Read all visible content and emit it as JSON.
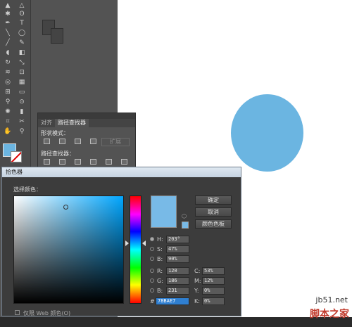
{
  "colors": {
    "accent": "#78bae7",
    "ellipse": "#6bb5e1",
    "dark_ui": "#535353"
  },
  "pathfinder": {
    "tabs": [
      "对齐",
      "路径查找器"
    ],
    "shape_modes_label": "形状模式：",
    "pathfinders_label": "路径查找器：",
    "expand_label": "扩展"
  },
  "picker": {
    "title": "拾色器",
    "select_color_label": "选择颜色：",
    "buttons": {
      "ok": "确定",
      "cancel": "取消",
      "swatches": "颜色色板"
    },
    "fields": {
      "H": {
        "label": "H:",
        "value": "203°"
      },
      "S": {
        "label": "S:",
        "value": "47%"
      },
      "B": {
        "label": "B:",
        "value": "90%"
      },
      "R": {
        "label": "R:",
        "value": "120"
      },
      "G": {
        "label": "G:",
        "value": "186"
      },
      "Bl": {
        "label": "B:",
        "value": "231"
      },
      "C": {
        "label": "C:",
        "value": "53%"
      },
      "M": {
        "label": "M:",
        "value": "12%"
      },
      "Y": {
        "label": "Y:",
        "value": "0%"
      },
      "K": {
        "label": "K:",
        "value": "0%"
      },
      "hex": {
        "label": "#",
        "value": "78BAE7"
      }
    },
    "web_only_label": "仅限 Web 颜色(O)"
  },
  "watermark": {
    "url": "jb51.net",
    "site": "脚本之家"
  }
}
